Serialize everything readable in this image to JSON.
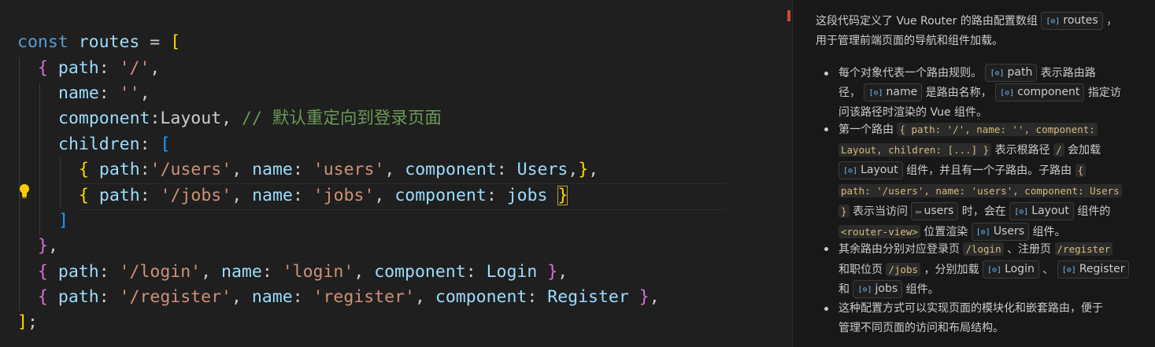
{
  "editor": {
    "lines": [
      [
        [
          "kw",
          "const"
        ],
        [
          "pl",
          " "
        ],
        [
          "var",
          "routes"
        ],
        [
          "pl",
          " = "
        ],
        [
          "b1",
          "["
        ]
      ],
      [
        [
          "b2",
          "{"
        ],
        [
          "pl",
          " "
        ],
        [
          "var",
          "path"
        ],
        [
          "pl",
          ": "
        ],
        [
          "str",
          "'/'"
        ],
        [
          "pl",
          ","
        ]
      ],
      [
        [
          "var",
          "name"
        ],
        [
          "pl",
          ": "
        ],
        [
          "str",
          "''"
        ],
        [
          "pl",
          ","
        ]
      ],
      [
        [
          "var",
          "component"
        ],
        [
          "pl",
          ":Layout, "
        ],
        [
          "cm",
          "// 默认重定向到登录页面"
        ]
      ],
      [
        [
          "var",
          "children"
        ],
        [
          "pl",
          ": "
        ],
        [
          "b3",
          "["
        ]
      ],
      [
        [
          "b1",
          "{"
        ],
        [
          "pl",
          " "
        ],
        [
          "var",
          "path"
        ],
        [
          "pl",
          ":"
        ],
        [
          "str",
          "'/users'"
        ],
        [
          "pl",
          ", "
        ],
        [
          "var",
          "name"
        ],
        [
          "pl",
          ": "
        ],
        [
          "str",
          "'users'"
        ],
        [
          "pl",
          ", "
        ],
        [
          "var",
          "component"
        ],
        [
          "pl",
          ": "
        ],
        [
          "var",
          "Users"
        ],
        [
          "pl",
          ","
        ],
        [
          "b1",
          "}"
        ],
        [
          "pl",
          ","
        ]
      ],
      [
        [
          "b1",
          "{"
        ],
        [
          "pl",
          " "
        ],
        [
          "var",
          "path"
        ],
        [
          "pl",
          ": "
        ],
        [
          "str",
          "'/jobs'"
        ],
        [
          "pl",
          ", "
        ],
        [
          "var",
          "name"
        ],
        [
          "pl",
          ": "
        ],
        [
          "str",
          "'jobs'"
        ],
        [
          "pl",
          ", "
        ],
        [
          "var",
          "component"
        ],
        [
          "pl",
          ": "
        ],
        [
          "var",
          "jobs"
        ],
        [
          "pl",
          " "
        ],
        [
          "b1",
          "}"
        ]
      ],
      [
        [
          "b3",
          "]"
        ]
      ],
      [
        [
          "b2",
          "}"
        ],
        [
          "pl",
          ","
        ]
      ],
      [
        [
          "b2",
          "{"
        ],
        [
          "pl",
          " "
        ],
        [
          "var",
          "path"
        ],
        [
          "pl",
          ": "
        ],
        [
          "str",
          "'/login'"
        ],
        [
          "pl",
          ", "
        ],
        [
          "var",
          "name"
        ],
        [
          "pl",
          ": "
        ],
        [
          "str",
          "'login'"
        ],
        [
          "pl",
          ", "
        ],
        [
          "var",
          "component"
        ],
        [
          "pl",
          ": "
        ],
        [
          "var",
          "Login"
        ],
        [
          "pl",
          " "
        ],
        [
          "b2",
          "}"
        ],
        [
          "pl",
          ","
        ]
      ],
      [
        [
          "b2",
          "{"
        ],
        [
          "pl",
          " "
        ],
        [
          "var",
          "path"
        ],
        [
          "pl",
          ": "
        ],
        [
          "str",
          "'/register'"
        ],
        [
          "pl",
          ", "
        ],
        [
          "var",
          "name"
        ],
        [
          "pl",
          ": "
        ],
        [
          "str",
          "'register'"
        ],
        [
          "pl",
          ", "
        ],
        [
          "var",
          "component"
        ],
        [
          "pl",
          ": "
        ],
        [
          "var",
          "Register"
        ],
        [
          "pl",
          " "
        ],
        [
          "b2",
          "}"
        ],
        [
          "pl",
          ","
        ]
      ],
      [
        [
          "b1",
          "]"
        ],
        [
          "pl",
          ";"
        ]
      ]
    ]
  },
  "chat": {
    "intro_a": "这段代码定义了 Vue Router 的路由配置数组",
    "intro_sym": "routes",
    "intro_b": "，",
    "intro_c": "用于管理前端页面的导航和组件加载。",
    "b1": {
      "t1": "每个对象代表一个路由规则。",
      "s1": "path",
      "t2": "表示路由路",
      "t3": "径，",
      "s2": "name",
      "t4": "是路由名称，",
      "s3": "component",
      "t5": "指定访",
      "t6": "问该路径时渲染的 Vue 组件。"
    },
    "b2": {
      "t1": "第一个路由",
      "c1": "{ path: '/', name: '', component:",
      "c2": "Layout, children: [...] }",
      "t2": "表示根路径",
      "c3": "/",
      "t3": "会加载",
      "s1": "Layout",
      "t4": "组件，并且有一个子路由。子路由",
      "c4": "{",
      "c5": "path: '/users', name: 'users', component: Users",
      "c6": "}",
      "t5": "表示当访问",
      "s2": "users",
      "t6": "时，会在",
      "s3": "Layout",
      "t7": "组件的",
      "c7": "<router-view>",
      "t8": "位置渲染",
      "s4": "Users",
      "t9": "组件。"
    },
    "b3": {
      "t1": "其余路由分别对应登录页",
      "c1": "/login",
      "t2": "、注册页",
      "c2": "/register",
      "t3": "和职位页",
      "c3": "/jobs",
      "t4": "，分别加载",
      "s1": "Login",
      "t5": "、",
      "s2": "Register",
      "t6": "和",
      "s3": "jobs",
      "t7": "组件。"
    },
    "b4": {
      "t1": "这种配置方式可以实现页面的模块化和嵌套路由，便于",
      "t2": "管理不同页面的访问和布局结构。"
    }
  },
  "icons": {
    "variable": "variable-symbol-icon",
    "file": "file-symbol-icon",
    "hint": "lightbulb-icon"
  },
  "colors": {
    "keyword": "#569cd6",
    "variable": "#9cdcfe",
    "string": "#ce9178",
    "comment": "#6a9955"
  }
}
